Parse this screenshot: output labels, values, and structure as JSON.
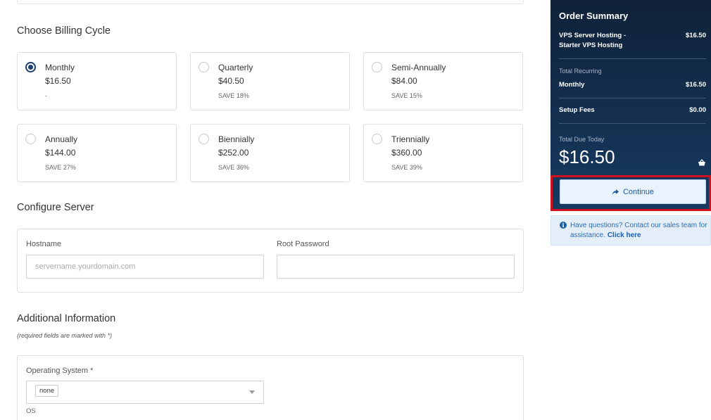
{
  "billing": {
    "title": "Choose Billing Cycle",
    "options": [
      {
        "name": "Monthly",
        "price": "$16.50",
        "save": "-",
        "selected": true
      },
      {
        "name": "Quarterly",
        "price": "$40.50",
        "save": "SAVE 18%",
        "selected": false
      },
      {
        "name": "Semi-Annually",
        "price": "$84.00",
        "save": "SAVE 15%",
        "selected": false
      },
      {
        "name": "Annually",
        "price": "$144.00",
        "save": "SAVE 27%",
        "selected": false
      },
      {
        "name": "Biennially",
        "price": "$252.00",
        "save": "SAVE 36%",
        "selected": false
      },
      {
        "name": "Triennially",
        "price": "$360.00",
        "save": "SAVE 39%",
        "selected": false
      }
    ]
  },
  "server": {
    "title": "Configure Server",
    "hostname_label": "Hostname",
    "hostname_placeholder": "servername.yourdomain.com",
    "hostname_value": "",
    "password_label": "Root Password",
    "password_value": ""
  },
  "additional": {
    "title": "Additional Information",
    "note": "(required fields are marked with *)",
    "os_label": "Operating System *",
    "os_value": "none",
    "os_help": "OS"
  },
  "summary": {
    "title": "Order Summary",
    "product_line1": "VPS Server Hosting -",
    "product_line2": "Starter VPS Hosting",
    "product_price": "$16.50",
    "recurring_label": "Total Recurring",
    "monthly_label": "Monthly",
    "monthly_value": "$16.50",
    "setup_label": "Setup Fees",
    "setup_value": "$0.00",
    "due_label": "Total Due Today",
    "due_value": "$16.50",
    "continue_label": "Continue"
  },
  "help": {
    "text": "Have questions? Contact our sales team for assistance.",
    "link": "Click here"
  },
  "colors": {
    "summary_bg": "#173a61",
    "accent": "#1c5fa8",
    "highlight": "#d0121f"
  }
}
